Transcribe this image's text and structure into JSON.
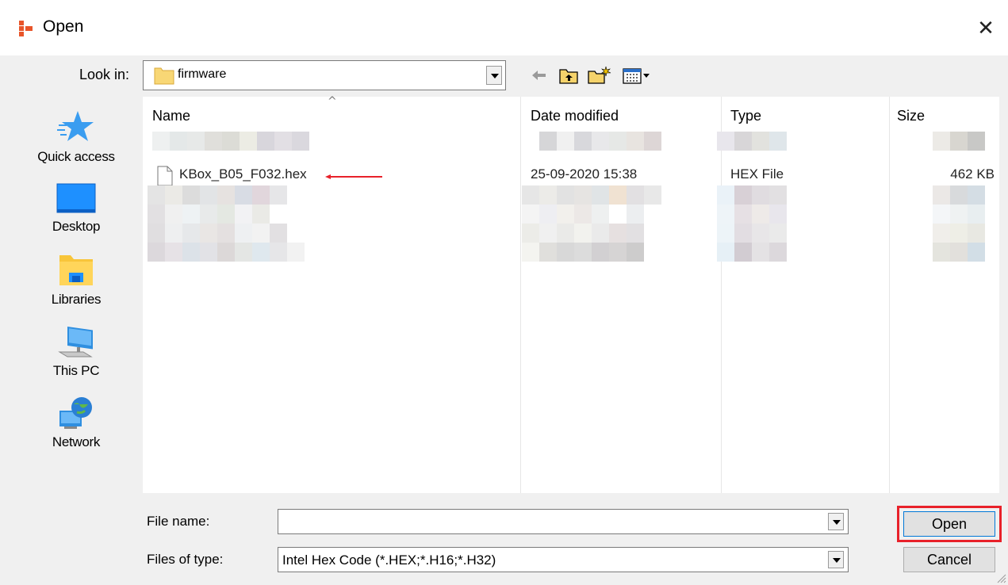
{
  "window": {
    "title": "Open",
    "close_glyph": "✕"
  },
  "lookin": {
    "label": "Look in:",
    "value": "firmware"
  },
  "toolbar": {
    "icons": [
      "back-arrow-icon",
      "up-folder-icon",
      "new-folder-icon",
      "view-menu-icon"
    ]
  },
  "places": [
    {
      "label": "Quick access",
      "icon": "star-icon"
    },
    {
      "label": "Desktop",
      "icon": "desktop-icon"
    },
    {
      "label": "Libraries",
      "icon": "libraries-icon"
    },
    {
      "label": "This PC",
      "icon": "computer-icon"
    },
    {
      "label": "Network",
      "icon": "network-icon"
    }
  ],
  "columns": {
    "name": "Name",
    "date": "Date modified",
    "type": "Type",
    "size": "Size"
  },
  "file": {
    "name": "KBox_B05_F032.hex",
    "date": "25-09-2020 15:38",
    "type": "HEX File",
    "size": "462 KB"
  },
  "filename": {
    "label": "File name:",
    "value": ""
  },
  "filetype": {
    "label": "Files of type:",
    "value": "Intel Hex Code (*.HEX;*.H16;*.H32)"
  },
  "buttons": {
    "open": "Open",
    "cancel": "Cancel"
  },
  "colors": {
    "highlight": "#e8212a",
    "arrow": "#e8212a",
    "folder": "#f8d775"
  }
}
